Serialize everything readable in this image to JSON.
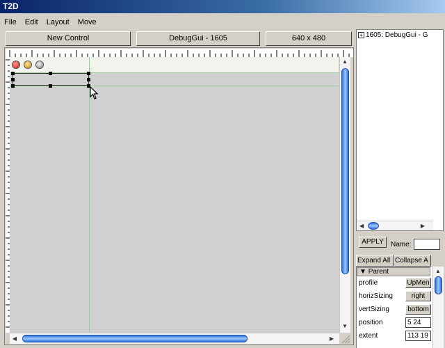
{
  "window": {
    "title": "T2D"
  },
  "menu": [
    "File",
    "Edit",
    "Layout",
    "Move"
  ],
  "header": {
    "new_control_label": "New Control",
    "gui_name": "DebugGui - 1605",
    "resolution": "640 x 480"
  },
  "tree": {
    "expander": "+",
    "item_label": "1605: DebugGui - G"
  },
  "apply": {
    "button_label": "APPLY",
    "name_label": "Name:",
    "name_value": ""
  },
  "inspector_buttons": {
    "expand_all": "Expand All",
    "collapse_all": "Collapse A"
  },
  "inspector": {
    "group_arrow": "▼",
    "group_label": "Parent",
    "fields": [
      {
        "label": "profile",
        "value": "UpMen"
      },
      {
        "label": "horizSizing",
        "value": "right"
      },
      {
        "label": "vertSizing",
        "value": "bottom"
      },
      {
        "label": "position",
        "value": "5 24"
      },
      {
        "label": "extent",
        "value": "113 19"
      }
    ]
  },
  "icons": {
    "close": "close-icon",
    "minimize": "minimize-icon",
    "maximize": "maximize-icon",
    "cursor": "mouse-cursor-icon"
  },
  "colors": {
    "titlebar_start": "#0a246a",
    "scroll_thumb": "#2d6fd6",
    "canvas": "#d0d0d0",
    "guide": "#9ccc9c"
  }
}
